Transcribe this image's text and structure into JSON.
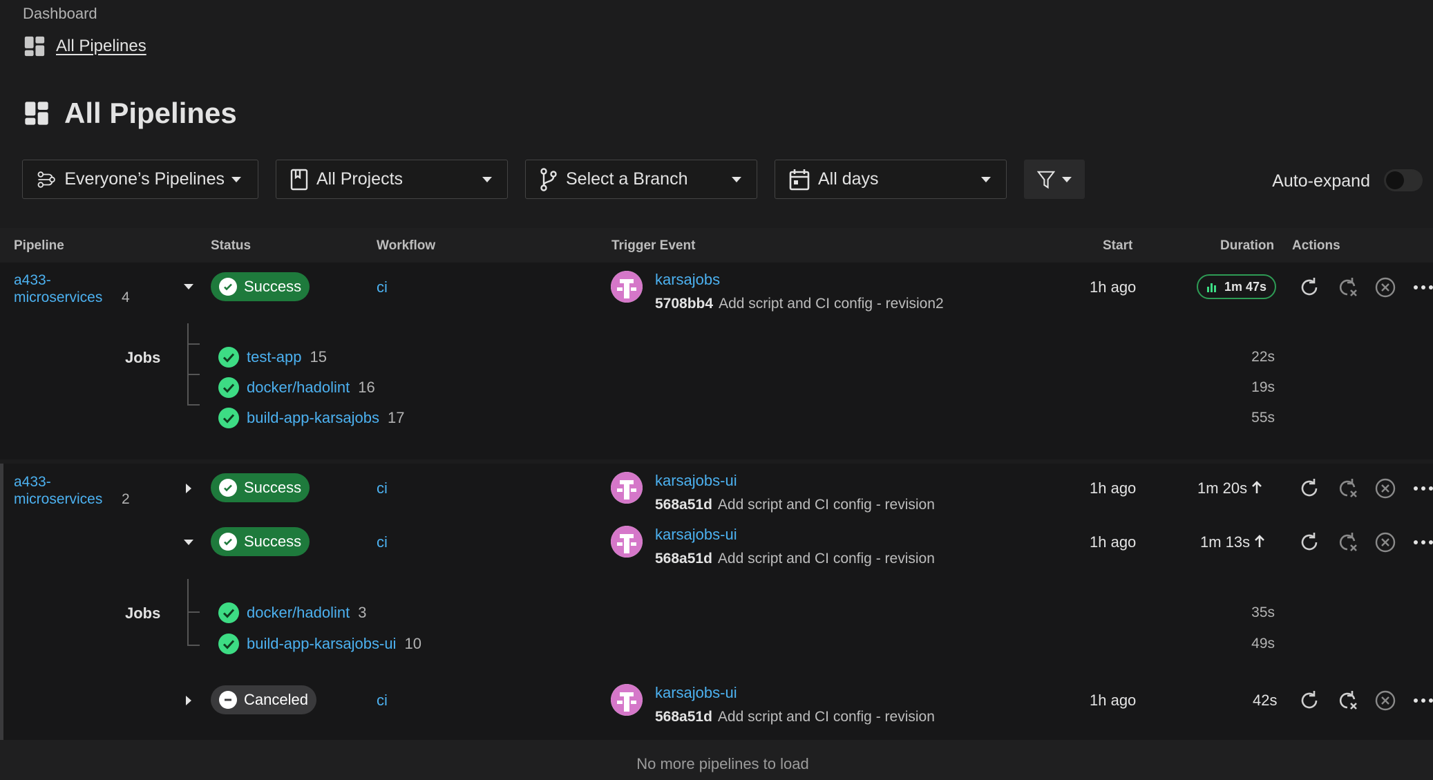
{
  "breadcrumb": {
    "parent": "Dashboard",
    "current": "All Pipelines"
  },
  "page_title": "All Pipelines",
  "filters": {
    "pipelines": "Everyone’s Pipelines",
    "projects": "All Projects",
    "branch": "Select a Branch",
    "days": "All days"
  },
  "auto_expand": {
    "label": "Auto-expand",
    "on": false
  },
  "table": {
    "columns": {
      "pipeline": "Pipeline",
      "status": "Status",
      "workflow": "Workflow",
      "trigger": "Trigger Event",
      "start": "Start",
      "duration": "Duration",
      "actions": "Actions"
    },
    "jobs_label": "Jobs",
    "groups": [
      {
        "project": "a433-microservices",
        "number": "4",
        "rows": [
          {
            "status": "Success",
            "workflow": "ci",
            "user": "karsajobs",
            "sha": "5708bb4",
            "message": "Add script and CI config - revision2",
            "start": "1h ago",
            "duration": "1m 47s",
            "jobs": [
              {
                "name": "test-app",
                "number": "15",
                "duration": "22s"
              },
              {
                "name": "docker/hadolint",
                "number": "16",
                "duration": "19s"
              },
              {
                "name": "build-app-karsajobs",
                "number": "17",
                "duration": "55s"
              }
            ]
          }
        ]
      },
      {
        "project": "a433-microservices",
        "number": "2",
        "rows": [
          {
            "status": "Success",
            "workflow": "ci",
            "user": "karsajobs-ui",
            "sha": "568a51d",
            "message": "Add script and CI config - revision",
            "start": "1h ago",
            "duration": "1m 20s"
          },
          {
            "status": "Success",
            "workflow": "ci",
            "user": "karsajobs-ui",
            "sha": "568a51d",
            "message": "Add script and CI config - revision",
            "start": "1h ago",
            "duration": "1m 13s",
            "jobs": [
              {
                "name": "docker/hadolint",
                "number": "3",
                "duration": "35s"
              },
              {
                "name": "build-app-karsajobs-ui",
                "number": "10",
                "duration": "49s"
              }
            ]
          },
          {
            "status": "Canceled",
            "workflow": "ci",
            "user": "karsajobs-ui",
            "sha": "568a51d",
            "message": "Add script and CI config - revision",
            "start": "1h ago",
            "duration": "42s"
          }
        ]
      }
    ]
  },
  "footer": "No more pipelines to load",
  "colors": {
    "success": "#1e7a3c",
    "link": "#4cb1f0",
    "check": "#3ddc84"
  }
}
